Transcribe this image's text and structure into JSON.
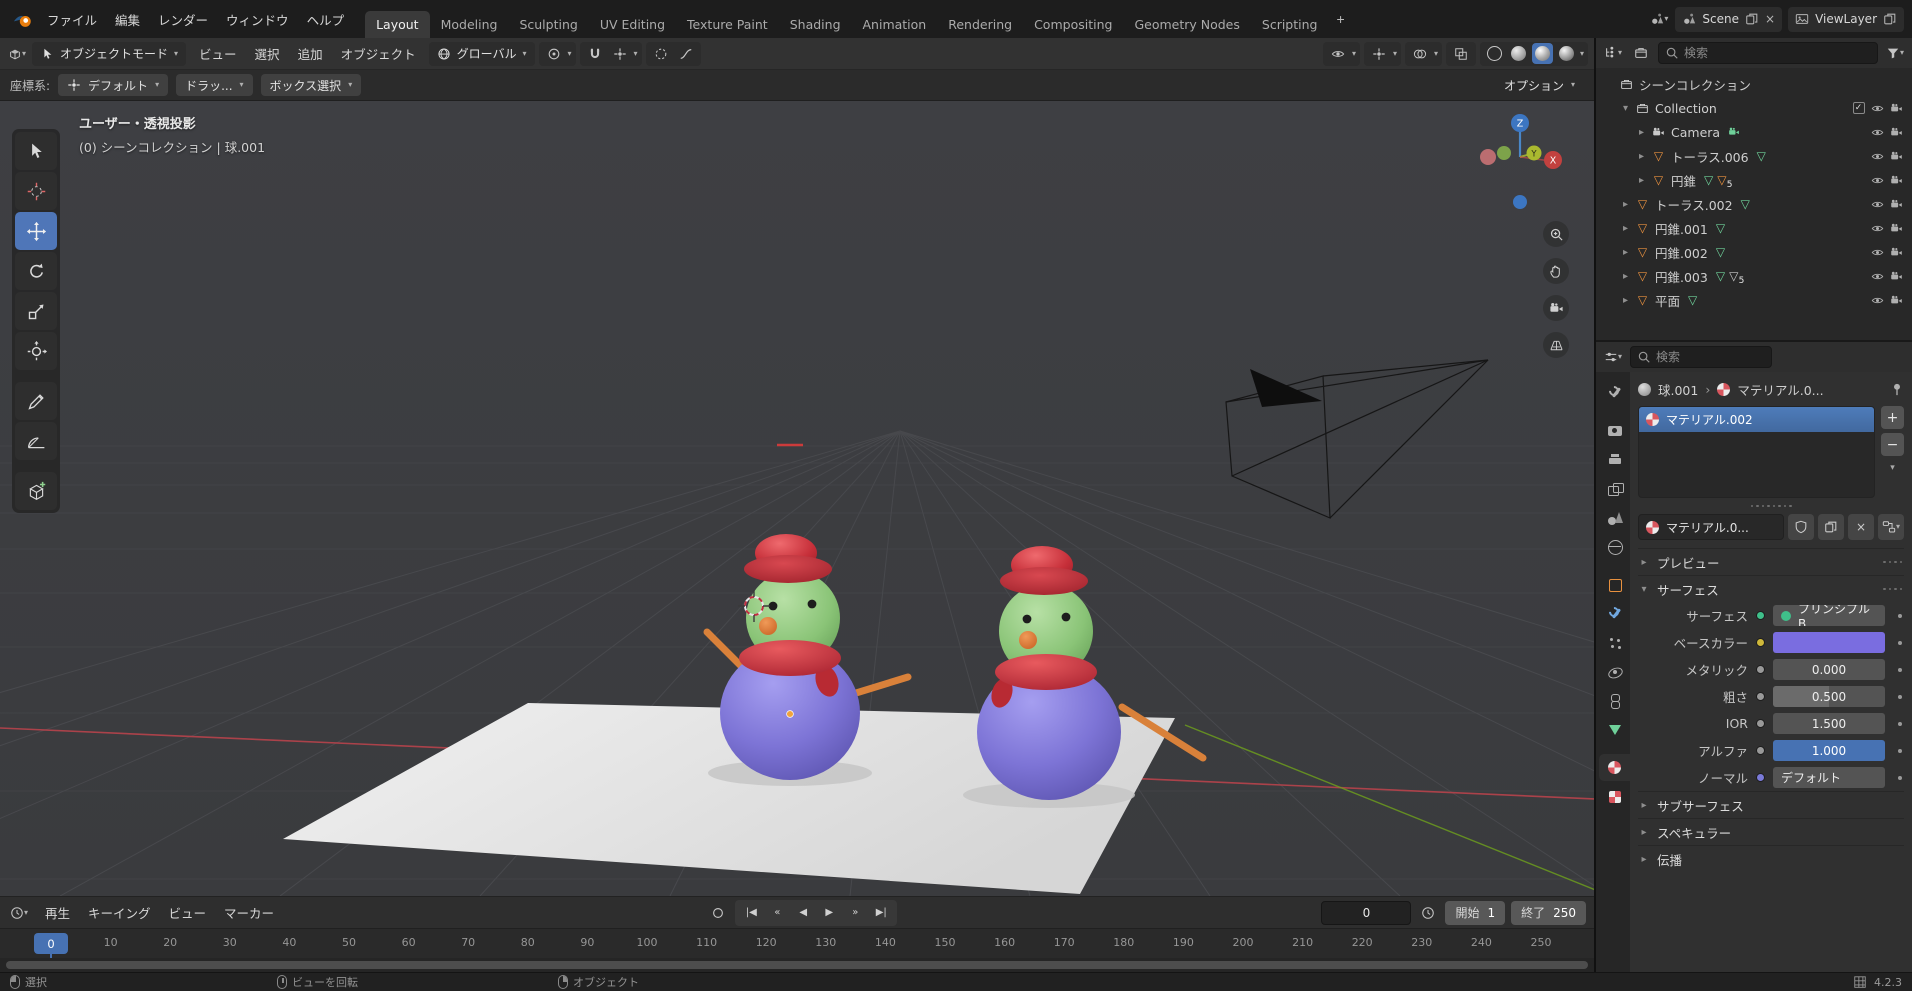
{
  "colors": {
    "accent": "#4772b3",
    "object_orange": "#e8913f",
    "data_green": "#6fd19a",
    "axis_x": "#b8434c",
    "axis_y": "#6fa21c",
    "snowman_body": "#7f76d8",
    "snowman_head": "#8fc87e",
    "snowman_hat": "#cc3038",
    "snowman_nose": "#e07f3e",
    "plane": "#e9e9e9"
  },
  "topbar": {
    "menus": [
      "ファイル",
      "編集",
      "レンダー",
      "ウィンドウ",
      "ヘルプ"
    ],
    "workspaces": [
      "Layout",
      "Modeling",
      "Sculpting",
      "UV Editing",
      "Texture Paint",
      "Shading",
      "Animation",
      "Rendering",
      "Compositing",
      "Geometry Nodes",
      "Scripting"
    ],
    "active_workspace": "Layout",
    "add_workspace": "+",
    "scene_label": "Scene",
    "viewlayer_label": "ViewLayer"
  },
  "viewport_header": {
    "mode": "オブジェクトモード",
    "menus": [
      "ビュー",
      "選択",
      "追加",
      "オブジェクト"
    ],
    "orientation": "グローバル"
  },
  "tool_settings": {
    "coord_label": "座標系:",
    "coord_value": "デフォルト",
    "drag_value": "ドラッ...",
    "select_value": "ボックス選択",
    "options_label": "オプション"
  },
  "left_toolbar": {
    "active_tool": "move",
    "tools": [
      "select-box",
      "cursor",
      "move",
      "rotate",
      "scale",
      "transform",
      "annotate",
      "measure",
      "add-cube"
    ]
  },
  "viewport": {
    "overlay_line1": "ユーザー・透視投影",
    "overlay_line2": "(0) シーンコレクション | 球.001",
    "gizmo": {
      "x": "X",
      "y": "Y",
      "z": "Z"
    }
  },
  "outliner": {
    "search_placeholder": "検索",
    "rows": [
      {
        "label": "シーンコレクション",
        "indent": 0,
        "icon": "collection",
        "arrow": "",
        "badges": [],
        "controls": []
      },
      {
        "label": "Collection",
        "indent": 1,
        "icon": "collection",
        "arrow": "down",
        "badges": [],
        "controls": [
          "checkbox",
          "eye",
          "camera"
        ]
      },
      {
        "label": "Camera",
        "indent": 2,
        "icon": "camera",
        "arrow": "right",
        "badges": [
          {
            "type": "camera-data",
            "color": "#6fd19a"
          }
        ],
        "controls": [
          "eye",
          "camera"
        ]
      },
      {
        "label": "トーラス.006",
        "indent": 2,
        "icon": "mesh",
        "arrow": "right",
        "badges": [
          {
            "type": "mesh-data",
            "color": "#6fd19a"
          }
        ],
        "controls": [
          "eye",
          "camera"
        ]
      },
      {
        "label": "円錐",
        "indent": 2,
        "icon": "mesh",
        "arrow": "right",
        "badges": [
          {
            "type": "mesh-data",
            "color": "#6fd19a"
          },
          {
            "type": "modifier-count",
            "color": "#e8913f",
            "count": "5"
          }
        ],
        "controls": [
          "eye",
          "camera"
        ]
      },
      {
        "label": "トーラス.002",
        "indent": 1,
        "icon": "mesh",
        "arrow": "right",
        "badges": [
          {
            "type": "mesh-data",
            "color": "#6fd19a"
          }
        ],
        "controls": [
          "eye",
          "camera"
        ]
      },
      {
        "label": "円錐.001",
        "indent": 1,
        "icon": "mesh",
        "arrow": "right",
        "badges": [
          {
            "type": "mesh-data",
            "color": "#6fd19a"
          }
        ],
        "controls": [
          "eye",
          "camera"
        ]
      },
      {
        "label": "円錐.002",
        "indent": 1,
        "icon": "mesh",
        "arrow": "right",
        "badges": [
          {
            "type": "mesh-data",
            "color": "#6fd19a"
          }
        ],
        "controls": [
          "eye",
          "camera"
        ]
      },
      {
        "label": "円錐.003",
        "indent": 1,
        "icon": "mesh",
        "arrow": "right",
        "badges": [
          {
            "type": "mesh-data",
            "color": "#6fd19a"
          },
          {
            "type": "modifier-count",
            "color": "#c9c9c9",
            "count": "5"
          }
        ],
        "controls": [
          "eye",
          "camera"
        ]
      },
      {
        "label": "平面",
        "indent": 1,
        "icon": "mesh",
        "arrow": "right",
        "badges": [
          {
            "type": "mesh-data",
            "color": "#6fd19a"
          }
        ],
        "controls": [
          "eye",
          "camera"
        ]
      }
    ]
  },
  "properties": {
    "search_placeholder": "検索",
    "breadcrumb_object": "球.001",
    "breadcrumb_separator": "›",
    "breadcrumb_material": "マテリアル.0...",
    "slot_selected": "マテリアル.002",
    "browse_name": "マテリアル.0...",
    "panel_preview": "プレビュー",
    "panel_surface": "サーフェス",
    "panel_subsurface": "サブサーフェス",
    "panel_specular": "スペキュラー",
    "panel_transmission": "伝播",
    "surface_rows": [
      {
        "label": "サーフェス",
        "type": "dropdown",
        "value": "プリンシプルB...",
        "socket": "#3fbf8a",
        "dot_in_field": true
      },
      {
        "label": "ベースカラー",
        "type": "color",
        "value": "",
        "socket": "#cfb83a",
        "swatch": "#7a6de0"
      },
      {
        "label": "メタリック",
        "type": "value",
        "value": "0.000",
        "socket": "#999999",
        "fill": 0
      },
      {
        "label": "粗さ",
        "type": "slider",
        "value": "0.500",
        "socket": "#999999",
        "fill": 0.5
      },
      {
        "label": "IOR",
        "type": "value",
        "value": "1.500",
        "socket": "#999999",
        "fill": 0
      },
      {
        "label": "アルファ",
        "type": "slider-accent",
        "value": "1.000",
        "socket": "#999999",
        "fill": 1
      },
      {
        "label": "ノーマル",
        "type": "dropdown",
        "value": "デフォルト",
        "socket": "#7a7ad8",
        "dot_in_field": false
      }
    ]
  },
  "property_tabs": {
    "active": "material",
    "tabs": [
      "tool",
      "render",
      "output",
      "view-layer",
      "scene",
      "world",
      "object",
      "modifiers",
      "particles",
      "physics",
      "constraints",
      "object-data",
      "material",
      "texture"
    ]
  },
  "timeline": {
    "menus": [
      "再生",
      "キーイング",
      "ビュー",
      "マーカー"
    ],
    "transport": [
      "jump-start",
      "jump-prev-key",
      "play-reverse",
      "play",
      "jump-next-key",
      "jump-end"
    ],
    "current_frame": "0",
    "start_label": "開始",
    "start_value": "1",
    "end_label": "終了",
    "end_value": "250",
    "ticks": [
      "0",
      "10",
      "20",
      "30",
      "40",
      "50",
      "60",
      "70",
      "80",
      "90",
      "100",
      "110",
      "120",
      "130",
      "140",
      "150",
      "160",
      "170",
      "180",
      "190",
      "200",
      "210",
      "220",
      "230",
      "240",
      "250"
    ]
  },
  "statusbar": {
    "hint_select": "選択",
    "hint_rotate": "ビューを回転",
    "hint_object": "オブジェクト",
    "version": "4.2.3"
  }
}
